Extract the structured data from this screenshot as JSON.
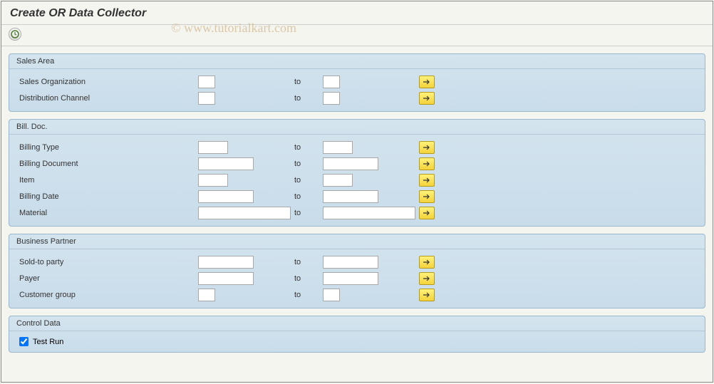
{
  "title": "Create OR Data Collector",
  "watermark": "© www.tutorialkart.com",
  "to_label": "to",
  "groups": {
    "salesArea": {
      "title": "Sales Area",
      "rows": {
        "salesOrg": "Sales Organization",
        "distChannel": "Distribution Channel"
      }
    },
    "billDoc": {
      "title": "Bill. Doc.",
      "rows": {
        "billingType": "Billing Type",
        "billingDocument": "Billing Document",
        "item": "Item",
        "billingDate": "Billing Date",
        "material": "Material"
      }
    },
    "businessPartner": {
      "title": "Business Partner",
      "rows": {
        "soldTo": "Sold-to party",
        "payer": "Payer",
        "custGroup": "Customer group"
      }
    },
    "controlData": {
      "title": "Control Data",
      "testRun": "Test Run"
    }
  }
}
